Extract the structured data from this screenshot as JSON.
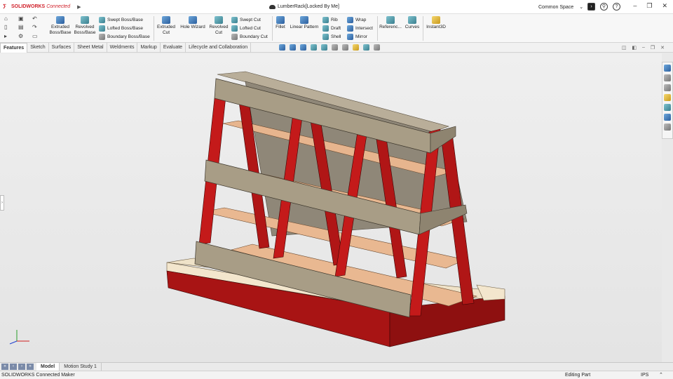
{
  "app": {
    "brand": "SOLIDWORKS",
    "brand_suffix": "Connected",
    "doc_title": "LumberRack[Locked By Me]",
    "space": "Common Space"
  },
  "ribbon": {
    "extruded_boss": "Extruded Boss/Base",
    "revolved_boss": "Revolved Boss/Base",
    "swept_boss": "Swept Boss/Base",
    "lofted_boss": "Lofted Boss/Base",
    "boundary_boss": "Boundary Boss/Base",
    "extruded_cut": "Extruded Cut",
    "hole_wizard": "Hole Wizard",
    "revolved_cut": "Revolved Cut",
    "swept_cut": "Swept Cut",
    "lofted_cut": "Lofted Cut",
    "boundary_cut": "Boundary Cut",
    "fillet": "Fillet",
    "linear_pattern": "Linear Pattern",
    "rib": "Rib",
    "draft": "Draft",
    "shell": "Shell",
    "wrap": "Wrap",
    "intersect": "Intersect",
    "mirror": "Mirror",
    "reference": "Referenc...",
    "curves": "Curves",
    "instant3d": "Instant3D"
  },
  "tabs": [
    "Features",
    "Sketch",
    "Surfaces",
    "Sheet Metal",
    "Weldments",
    "Markup",
    "Evaluate",
    "Lifecycle and Collaboration"
  ],
  "bottom_tabs": [
    "Model",
    "Motion Study 1"
  ],
  "status": {
    "product": "SOLIDWORKS Connected Maker",
    "mode": "Editing Part",
    "units": "IPS"
  },
  "colors": {
    "frame_red": "#c41a1a",
    "plywood": "#e9b891",
    "board": "#a89d86",
    "brand_red": "#d0202a"
  }
}
